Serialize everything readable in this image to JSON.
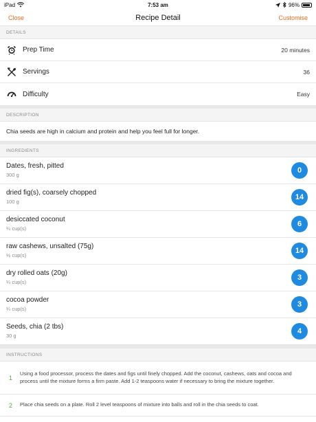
{
  "status": {
    "device": "iPad",
    "time": "7:53 am",
    "battery": "96%"
  },
  "nav": {
    "close_label": "Close",
    "title": "Recipe Detail",
    "customise_label": "Customise"
  },
  "details": {
    "header": "DETAILS",
    "rows": [
      {
        "icon": "alarm-clock-icon",
        "label": "Prep Time",
        "value": "20 minutes"
      },
      {
        "icon": "cutlery-icon",
        "label": "Servings",
        "value": "36"
      },
      {
        "icon": "gauge-icon",
        "label": "Difficulty",
        "value": "Easy"
      }
    ]
  },
  "description": {
    "header": "DESCRIPTION",
    "text": "Chia seeds are high in calcium and protein and help you feel full for longer."
  },
  "ingredients": {
    "header": "INGREDIENTS",
    "items": [
      {
        "name": "Dates, fresh, pitted",
        "qty": "300 g",
        "badge": "0"
      },
      {
        "name": "dried fig(s), coarsely chopped",
        "qty": "100 g",
        "badge": "14"
      },
      {
        "name": "desiccated coconut",
        "qty": "¼ cup(s)",
        "badge": "6"
      },
      {
        "name": "raw cashews, unsalted (75g)",
        "qty": "½ cup(s)",
        "badge": "14"
      },
      {
        "name": "dry rolled oats (20g)",
        "qty": "¼ cup(s)",
        "badge": "3"
      },
      {
        "name": "cocoa powder",
        "qty": "¼ cup(s)",
        "badge": "3"
      },
      {
        "name": "Seeds, chia (2 tbs)",
        "qty": "30 g",
        "badge": "4"
      }
    ]
  },
  "instructions": {
    "header": "INSTRUCTIONS",
    "steps": [
      {
        "num": "1",
        "text": "Using a food processor, process the dates and figs until finely chopped. Add the coconut, cashews, oats and cocoa and process until the mixture forms a firm paste. Add 1-2 teaspoons water if necessary to bring the mixture together."
      },
      {
        "num": "2",
        "text": "Place chia seeds on a plate. Roll 2 level teaspoons of mixture into balls and roll in the chia seeds to coat."
      }
    ]
  },
  "colors": {
    "accent": "#f06a1c",
    "badge": "#1f8be0",
    "step_number": "#4fae32"
  }
}
